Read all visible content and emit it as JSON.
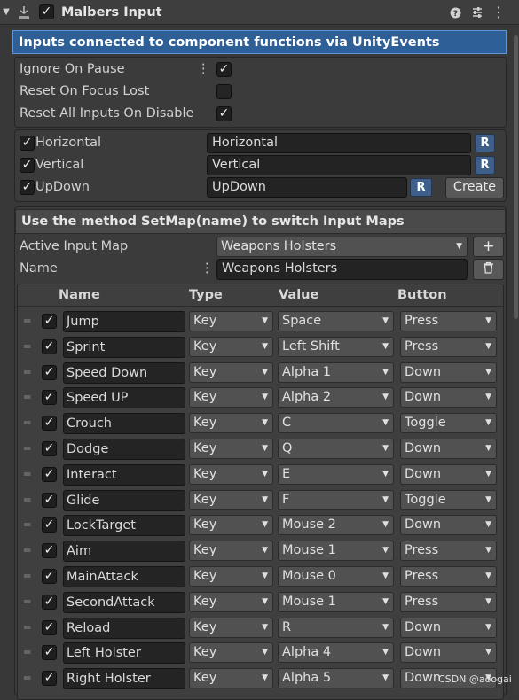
{
  "header": {
    "title": "Malbers Input",
    "enabled": true,
    "icons": [
      "foldout-arrow-icon",
      "script-icon",
      "help-icon",
      "preset-icon",
      "kebab-menu-icon"
    ]
  },
  "banner": {
    "text": "Inputs connected to component functions via UnityEvents"
  },
  "options": [
    {
      "label": "Ignore On Pause",
      "checked": true
    },
    {
      "label": "Reset On Focus Lost",
      "checked": false
    },
    {
      "label": "Reset All Inputs On Disable",
      "checked": true
    }
  ],
  "axes": [
    {
      "label": "Horizontal",
      "value": "Horizontal",
      "checked": true
    },
    {
      "label": "Vertical",
      "value": "Vertical",
      "checked": true
    },
    {
      "label": "UpDown",
      "value": "UpDown",
      "checked": true
    }
  ],
  "r_label": "R",
  "create_label": "Create",
  "map_section": {
    "title": "Use the method SetMap(name) to switch Input Maps",
    "active_label": "Active Input Map",
    "active_value": "Weapons Holsters",
    "name_label": "Name",
    "name_value": "Weapons Holsters",
    "add_label": "+"
  },
  "table": {
    "headers": [
      "Name",
      "Type",
      "Value",
      "Button"
    ],
    "rows": [
      {
        "name": "Jump",
        "type": "Key",
        "value": "Space",
        "button": "Press"
      },
      {
        "name": "Sprint",
        "type": "Key",
        "value": "Left Shift",
        "button": "Press"
      },
      {
        "name": "Speed Down",
        "type": "Key",
        "value": "Alpha 1",
        "button": "Down"
      },
      {
        "name": "Speed UP",
        "type": "Key",
        "value": "Alpha 2",
        "button": "Down"
      },
      {
        "name": "Crouch",
        "type": "Key",
        "value": "C",
        "button": "Toggle"
      },
      {
        "name": "Dodge",
        "type": "Key",
        "value": "Q",
        "button": "Down"
      },
      {
        "name": "Interact",
        "type": "Key",
        "value": "E",
        "button": "Down"
      },
      {
        "name": "Glide",
        "type": "Key",
        "value": "F",
        "button": "Toggle"
      },
      {
        "name": "LockTarget",
        "type": "Key",
        "value": "Mouse 2",
        "button": "Down"
      },
      {
        "name": "Aim",
        "type": "Key",
        "value": "Mouse 1",
        "button": "Press"
      },
      {
        "name": "MainAttack",
        "type": "Key",
        "value": "Mouse 0",
        "button": "Press"
      },
      {
        "name": "SecondAttack",
        "type": "Key",
        "value": "Mouse 1",
        "button": "Press"
      },
      {
        "name": "Reload",
        "type": "Key",
        "value": "R",
        "button": "Down"
      },
      {
        "name": "Left Holster",
        "type": "Key",
        "value": "Alpha 4",
        "button": "Down"
      },
      {
        "name": "Right Holster",
        "type": "Key",
        "value": "Alpha 5",
        "button": "Down"
      }
    ]
  },
  "watermark": "CSDN @aoogai"
}
